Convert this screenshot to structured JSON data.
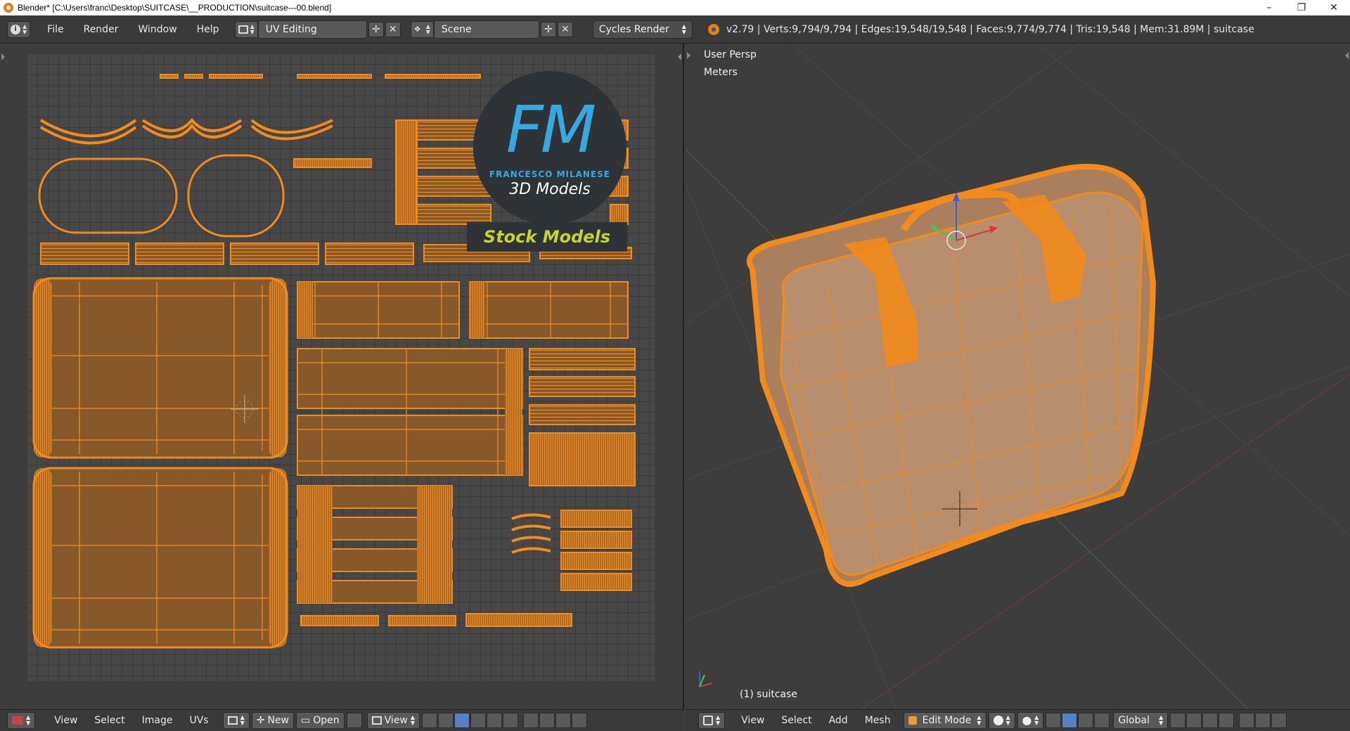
{
  "window": {
    "title": "Blender* [C:\\Users\\franc\\Desktop\\SUITCASE\\__PRODUCTION\\suitcase---00.blend]",
    "controls": [
      "–",
      "❐",
      "✕"
    ]
  },
  "info_header": {
    "menus": [
      "File",
      "Render",
      "Window",
      "Help"
    ],
    "screen_layout": "UV Editing",
    "scene": "Scene",
    "render_engine": "Cycles Render",
    "stats": "v2.79 | Verts:9,794/9,794 | Edges:19,548/19,548 | Faces:9,774/9,774 | Tris:19,548 | Mem:31.89M | suitcase"
  },
  "uv_editor": {
    "watermark": {
      "logo_letters": "FM",
      "brand_name": "FRANCESCO MILANESE",
      "brand_subtitle": "3D Models",
      "banner": "Stock Models"
    },
    "footer": {
      "menus": [
        "View",
        "Select",
        "Image",
        "UVs"
      ],
      "new_label": "New",
      "open_label": "Open",
      "view_label": "View"
    }
  },
  "viewport_3d": {
    "view_name": "User Persp",
    "units": "Meters",
    "object_label": "(1) suitcase",
    "footer": {
      "menus": [
        "View",
        "Select",
        "Add",
        "Mesh"
      ],
      "mode": "Edit Mode",
      "orientation": "Global"
    }
  },
  "colors": {
    "uv_orange": "#f28a1c",
    "island_fill": "#86582a",
    "mesh_face": "#b88e6c",
    "logo_blue": "#38a9e0",
    "banner_green": "#c8d42a"
  }
}
